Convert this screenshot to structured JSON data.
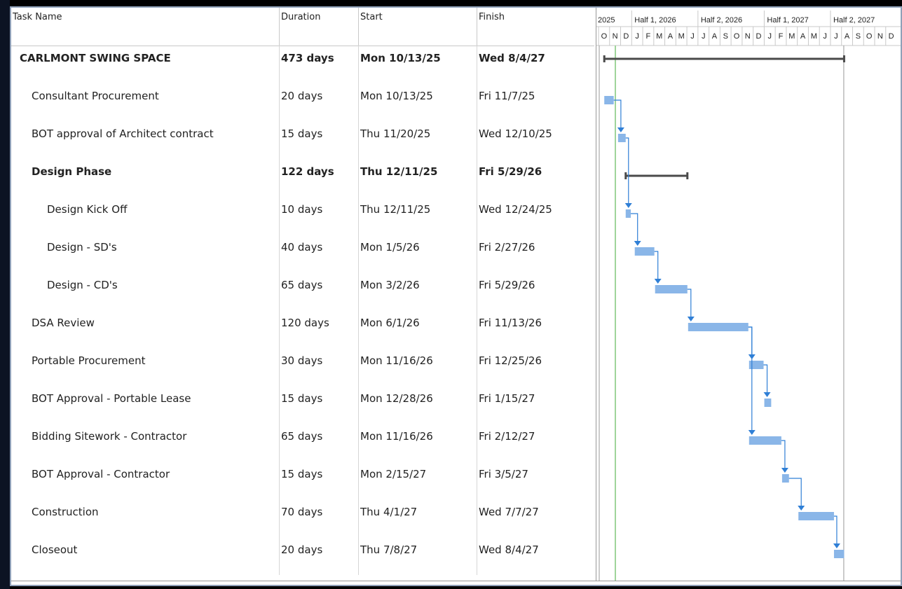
{
  "columns": {
    "task_name": "Task Name",
    "duration": "Duration",
    "start": "Start",
    "finish": "Finish"
  },
  "timescale": {
    "top": [
      "2025",
      "Half 1, 2026",
      "Half 2, 2026",
      "Half 1, 2027",
      "Half 2, 2027"
    ],
    "months": [
      "O",
      "N",
      "D",
      "J",
      "F",
      "M",
      "A",
      "M",
      "J",
      "J",
      "A",
      "S",
      "O",
      "N",
      "D",
      "J",
      "F",
      "M",
      "A",
      "M",
      "J",
      "J",
      "A",
      "S",
      "O",
      "N",
      "D"
    ]
  },
  "tasks": [
    {
      "name": "CARLMONT SWING SPACE",
      "duration": "473 days",
      "start": "Mon 10/13/25",
      "finish": "Wed 8/4/27",
      "summary": true,
      "level": 0
    },
    {
      "name": "Consultant Procurement",
      "duration": "20 days",
      "start": "Mon 10/13/25",
      "finish": "Fri 11/7/25",
      "summary": false,
      "level": 1
    },
    {
      "name": "BOT approval of Architect contract",
      "duration": "15 days",
      "start": "Thu 11/20/25",
      "finish": "Wed 12/10/25",
      "summary": false,
      "level": 1
    },
    {
      "name": "Design Phase",
      "duration": "122 days",
      "start": "Thu 12/11/25",
      "finish": "Fri 5/29/26",
      "summary": true,
      "level": 1
    },
    {
      "name": "Design Kick Off",
      "duration": "10 days",
      "start": "Thu 12/11/25",
      "finish": "Wed 12/24/25",
      "summary": false,
      "level": 2
    },
    {
      "name": "Design - SD's",
      "duration": "40 days",
      "start": "Mon 1/5/26",
      "finish": "Fri 2/27/26",
      "summary": false,
      "level": 2
    },
    {
      "name": "Design - CD's",
      "duration": "65 days",
      "start": "Mon 3/2/26",
      "finish": "Fri 5/29/26",
      "summary": false,
      "level": 2
    },
    {
      "name": "DSA Review",
      "duration": "120 days",
      "start": "Mon 6/1/26",
      "finish": "Fri 11/13/26",
      "summary": false,
      "level": 1
    },
    {
      "name": "Portable Procurement",
      "duration": "30 days",
      "start": "Mon 11/16/26",
      "finish": "Fri 12/25/26",
      "summary": false,
      "level": 1
    },
    {
      "name": "BOT Approval - Portable Lease",
      "duration": "15 days",
      "start": "Mon 12/28/26",
      "finish": "Fri 1/15/27",
      "summary": false,
      "level": 1
    },
    {
      "name": "Bidding Sitework - Contractor",
      "duration": "65 days",
      "start": "Mon 11/16/26",
      "finish": "Fri 2/12/27",
      "summary": false,
      "level": 1
    },
    {
      "name": "BOT Approval - Contractor",
      "duration": "15 days",
      "start": "Mon 2/15/27",
      "finish": "Fri 3/5/27",
      "summary": false,
      "level": 1
    },
    {
      "name": "Construction",
      "duration": "70 days",
      "start": "Thu 4/1/27",
      "finish": "Wed 7/7/27",
      "summary": false,
      "level": 1
    },
    {
      "name": "Closeout",
      "duration": "20 days",
      "start": "Thu 7/8/27",
      "finish": "Wed 8/4/27",
      "summary": false,
      "level": 1
    }
  ],
  "dependencies": [
    [
      1,
      2
    ],
    [
      2,
      4
    ],
    [
      4,
      5
    ],
    [
      5,
      6
    ],
    [
      6,
      7
    ],
    [
      7,
      8
    ],
    [
      8,
      9
    ],
    [
      7,
      10
    ],
    [
      10,
      11
    ],
    [
      11,
      12
    ],
    [
      12,
      13
    ]
  ],
  "colors": {
    "task_bar": "#8ab6e8",
    "summary_bar": "#4a4a4a",
    "link": "#2f7fd6",
    "today_line": "#9fd49a",
    "grid": "#d6d6d6"
  }
}
